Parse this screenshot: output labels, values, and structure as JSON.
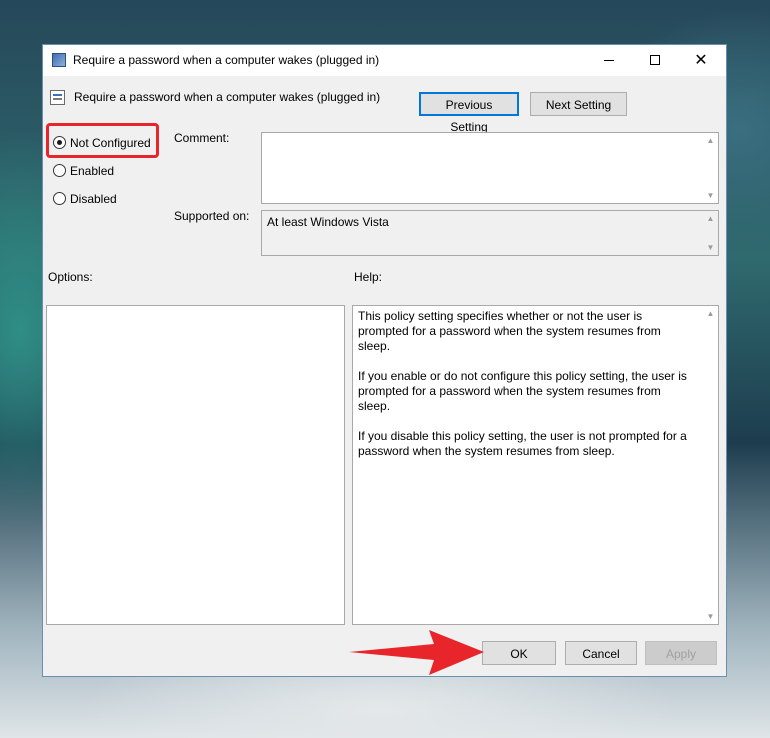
{
  "window": {
    "title": "Require a password when a computer wakes (plugged in)",
    "controls": {
      "minimize": "—",
      "maximize": "☐",
      "close": "✕"
    }
  },
  "header": {
    "setting_name": "Require a password when a computer wakes (plugged in)",
    "previous_button": "Previous Setting",
    "next_button": "Next Setting"
  },
  "state": {
    "options": [
      {
        "label": "Not Configured",
        "checked": true
      },
      {
        "label": "Enabled",
        "checked": false
      },
      {
        "label": "Disabled",
        "checked": false
      }
    ]
  },
  "comment": {
    "label": "Comment:",
    "value": ""
  },
  "supported": {
    "label": "Supported on:",
    "value": "At least Windows Vista"
  },
  "options_panel": {
    "label": "Options:"
  },
  "help_panel": {
    "label": "Help:",
    "paragraphs": [
      "This policy setting specifies whether or not the user is prompted for a password when the system resumes from sleep.",
      "If you enable or do not configure this policy setting, the user is prompted for a password when the system resumes from sleep.",
      "If you disable this policy setting, the user is not prompted for a password when the system resumes from sleep."
    ]
  },
  "footer": {
    "ok": "OK",
    "cancel": "Cancel",
    "apply": "Apply"
  },
  "annotations": {
    "highlight_color": "#e8252a",
    "arrow_color": "#e8252a"
  }
}
